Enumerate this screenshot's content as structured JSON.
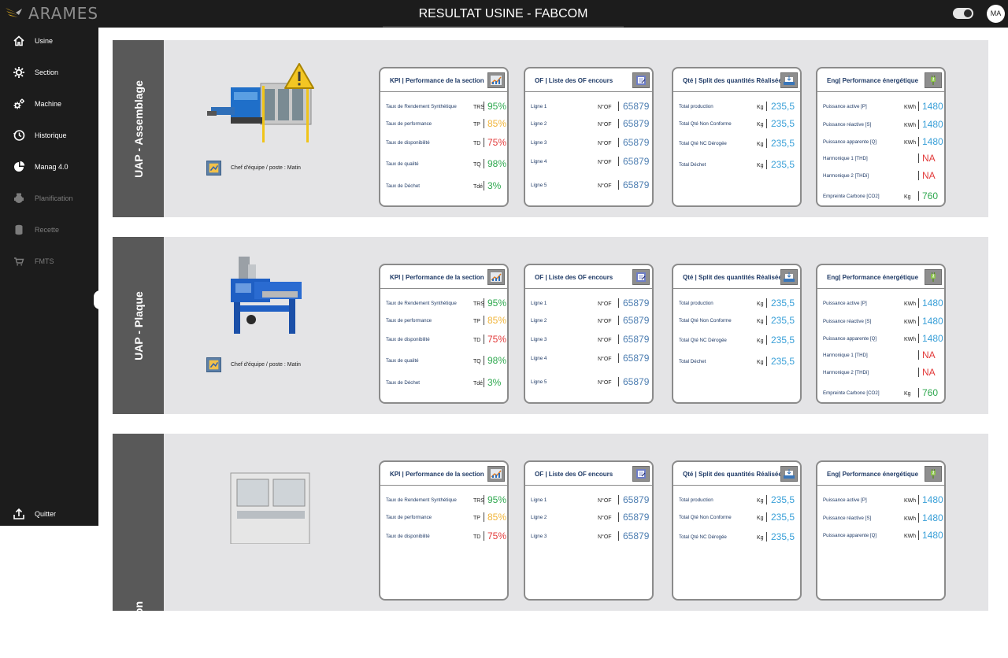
{
  "app": {
    "logo_text": "ARAMES",
    "title": "RESULTAT USINE - FABCOM",
    "avatar_initials": "MA"
  },
  "sidebar": {
    "items": [
      {
        "label": "Usine",
        "icon": "home-icon",
        "enabled": true
      },
      {
        "label": "Section",
        "icon": "gear-icon",
        "enabled": true
      },
      {
        "label": "Machine",
        "icon": "gears-icon",
        "enabled": true
      },
      {
        "label": "Historique",
        "icon": "history-icon",
        "enabled": true
      },
      {
        "label": "Manag 4.0",
        "icon": "pie-chart-icon",
        "enabled": true
      },
      {
        "label": "Planification",
        "icon": "planning-icon",
        "enabled": false
      },
      {
        "label": "Recette",
        "icon": "database-icon",
        "enabled": false
      },
      {
        "label": "FMTS",
        "icon": "cart-icon",
        "enabled": false
      }
    ],
    "quit_label": "Quitter"
  },
  "colors": {
    "blue": "#3aa0d8",
    "green": "#2fa84f",
    "orange": "#f0b43a",
    "red": "#e23b3b"
  },
  "sections": [
    {
      "name": "UAP - Assemblage",
      "chef_text": "Chef d'équipe  / poste : Matin",
      "has_warning": true,
      "kpi": {
        "title": "KPI | Performance de la section",
        "rows": [
          {
            "label": "Taux de Rendement Synthétique",
            "unit": "TRS",
            "value": "95%",
            "color": "green"
          },
          {
            "label": "Taux de performance",
            "unit": "TP",
            "value": "85%",
            "color": "orange"
          },
          {
            "label": "Taux de disponibilité",
            "unit": "TD",
            "value": "75%",
            "color": "red"
          },
          {
            "label": "Taux de qualité",
            "unit": "TQ",
            "value": "98%",
            "color": "green"
          },
          {
            "label": "Taux de Déchet",
            "unit": "Tdé",
            "value": "3%",
            "color": "green"
          }
        ]
      },
      "of": {
        "title": "OF | Liste des OF encours",
        "rows": [
          {
            "label": "Ligne 1",
            "unit": "N°OF",
            "value": "65879"
          },
          {
            "label": "Ligne 2",
            "unit": "N°OF",
            "value": "65879"
          },
          {
            "label": "Ligne 3",
            "unit": "N°OF",
            "value": "65879"
          },
          {
            "label": "Ligne 4",
            "unit": "N°OF",
            "value": "65879"
          },
          {
            "label": "Ligne 5",
            "unit": "N°OF",
            "value": "65879"
          }
        ]
      },
      "qte": {
        "title": "Qté | Split des quantités Réalisées",
        "rows": [
          {
            "label": "Total production",
            "unit": "Kg",
            "value": "235,5"
          },
          {
            "label": "Total Qté Non Conforme",
            "unit": "Kg",
            "value": "235,5"
          },
          {
            "label": "Total Qté NC Dérogée",
            "unit": "Kg",
            "value": "235,5"
          },
          {
            "label": "Total Déchet",
            "unit": "Kg",
            "value": "235,5"
          }
        ]
      },
      "eng": {
        "title": "Eng| Performance énergétique",
        "rows": [
          {
            "label": "Puissance active [P]",
            "unit": "KWh",
            "value": "1480",
            "color": "blue"
          },
          {
            "label": "Puissance réactive [S]",
            "unit": "KWh",
            "value": "1480",
            "color": "blue"
          },
          {
            "label": "Puissance apparente [Q]",
            "unit": "KWh",
            "value": "1480",
            "color": "blue"
          },
          {
            "label": "Harmonique 1 [THD]",
            "unit": "",
            "value": "NA",
            "color": "red"
          },
          {
            "label": "Harmonique 2 [THDi]",
            "unit": "",
            "value": "NA",
            "color": "red"
          },
          {
            "label": "Empreinte Carbone [CO2]",
            "unit": "Kg",
            "value": "760",
            "color": "green"
          }
        ]
      }
    },
    {
      "name": "UAP - Plaque",
      "chef_text": "Chef d'équipe  / poste : Matin",
      "has_warning": false,
      "kpi": {
        "title": "KPI | Performance de la section",
        "rows": [
          {
            "label": "Taux de Rendement Synthétique",
            "unit": "TRS",
            "value": "95%",
            "color": "green"
          },
          {
            "label": "Taux de performance",
            "unit": "TP",
            "value": "85%",
            "color": "orange"
          },
          {
            "label": "Taux de disponibilité",
            "unit": "TD",
            "value": "75%",
            "color": "red"
          },
          {
            "label": "Taux de qualité",
            "unit": "TQ",
            "value": "98%",
            "color": "green"
          },
          {
            "label": "Taux de Déchet",
            "unit": "Tdé",
            "value": "3%",
            "color": "green"
          }
        ]
      },
      "of": {
        "title": "OF | Liste des OF encours",
        "rows": [
          {
            "label": "Ligne 1",
            "unit": "N°OF",
            "value": "65879"
          },
          {
            "label": "Ligne 2",
            "unit": "N°OF",
            "value": "65879"
          },
          {
            "label": "Ligne 3",
            "unit": "N°OF",
            "value": "65879"
          },
          {
            "label": "Ligne 4",
            "unit": "N°OF",
            "value": "65879"
          },
          {
            "label": "Ligne 5",
            "unit": "N°OF",
            "value": "65879"
          }
        ]
      },
      "qte": {
        "title": "Qté | Split des quantités Réalisées",
        "rows": [
          {
            "label": "Total production",
            "unit": "Kg",
            "value": "235,5"
          },
          {
            "label": "Total Qté Non Conforme",
            "unit": "Kg",
            "value": "235,5"
          },
          {
            "label": "Total Qté NC Dérogée",
            "unit": "Kg",
            "value": "235,5"
          },
          {
            "label": "Total Déchet",
            "unit": "Kg",
            "value": "235,5"
          }
        ]
      },
      "eng": {
        "title": "Eng| Performance énergétique",
        "rows": [
          {
            "label": "Puissance active [P]",
            "unit": "KWh",
            "value": "1480",
            "color": "blue"
          },
          {
            "label": "Puissance réactive [S]",
            "unit": "KWh",
            "value": "1480",
            "color": "blue"
          },
          {
            "label": "Puissance apparente [Q]",
            "unit": "KWh",
            "value": "1480",
            "color": "blue"
          },
          {
            "label": "Harmonique 1 [THD]",
            "unit": "",
            "value": "NA",
            "color": "red"
          },
          {
            "label": "Harmonique 2 [THDi]",
            "unit": "",
            "value": "NA",
            "color": "red"
          },
          {
            "label": "Empreinte Carbone [CO2]",
            "unit": "Kg",
            "value": "760",
            "color": "green"
          }
        ]
      }
    },
    {
      "name": "rge finition",
      "chef_text": "",
      "has_warning": false,
      "kpi": {
        "title": "KPI | Performance de la section",
        "rows": [
          {
            "label": "Taux de Rendement Synthétique",
            "unit": "TRS",
            "value": "95%",
            "color": "green"
          },
          {
            "label": "Taux de performance",
            "unit": "TP",
            "value": "85%",
            "color": "orange"
          },
          {
            "label": "Taux de disponibilité",
            "unit": "TD",
            "value": "75%",
            "color": "red"
          }
        ]
      },
      "of": {
        "title": "OF | Liste des OF encours",
        "rows": [
          {
            "label": "Ligne 1",
            "unit": "N°OF",
            "value": "65879"
          },
          {
            "label": "Ligne 2",
            "unit": "N°OF",
            "value": "65879"
          },
          {
            "label": "Ligne 3",
            "unit": "N°OF",
            "value": "65879"
          }
        ]
      },
      "qte": {
        "title": "Qté | Split des quantités Réalisées",
        "rows": [
          {
            "label": "Total production",
            "unit": "Kg",
            "value": "235,5"
          },
          {
            "label": "Total Qté Non Conforme",
            "unit": "Kg",
            "value": "235,5"
          },
          {
            "label": "Total Qté NC Dérogée",
            "unit": "Kg",
            "value": "235,5"
          }
        ]
      },
      "eng": {
        "title": "Eng| Performance énergétique",
        "rows": [
          {
            "label": "Puissance active [P]",
            "unit": "KWh",
            "value": "1480",
            "color": "blue"
          },
          {
            "label": "Puissance réactive [S]",
            "unit": "KWh",
            "value": "1480",
            "color": "blue"
          },
          {
            "label": "Puissance apparente [Q]",
            "unit": "KWh",
            "value": "1480",
            "color": "blue"
          }
        ]
      }
    }
  ]
}
